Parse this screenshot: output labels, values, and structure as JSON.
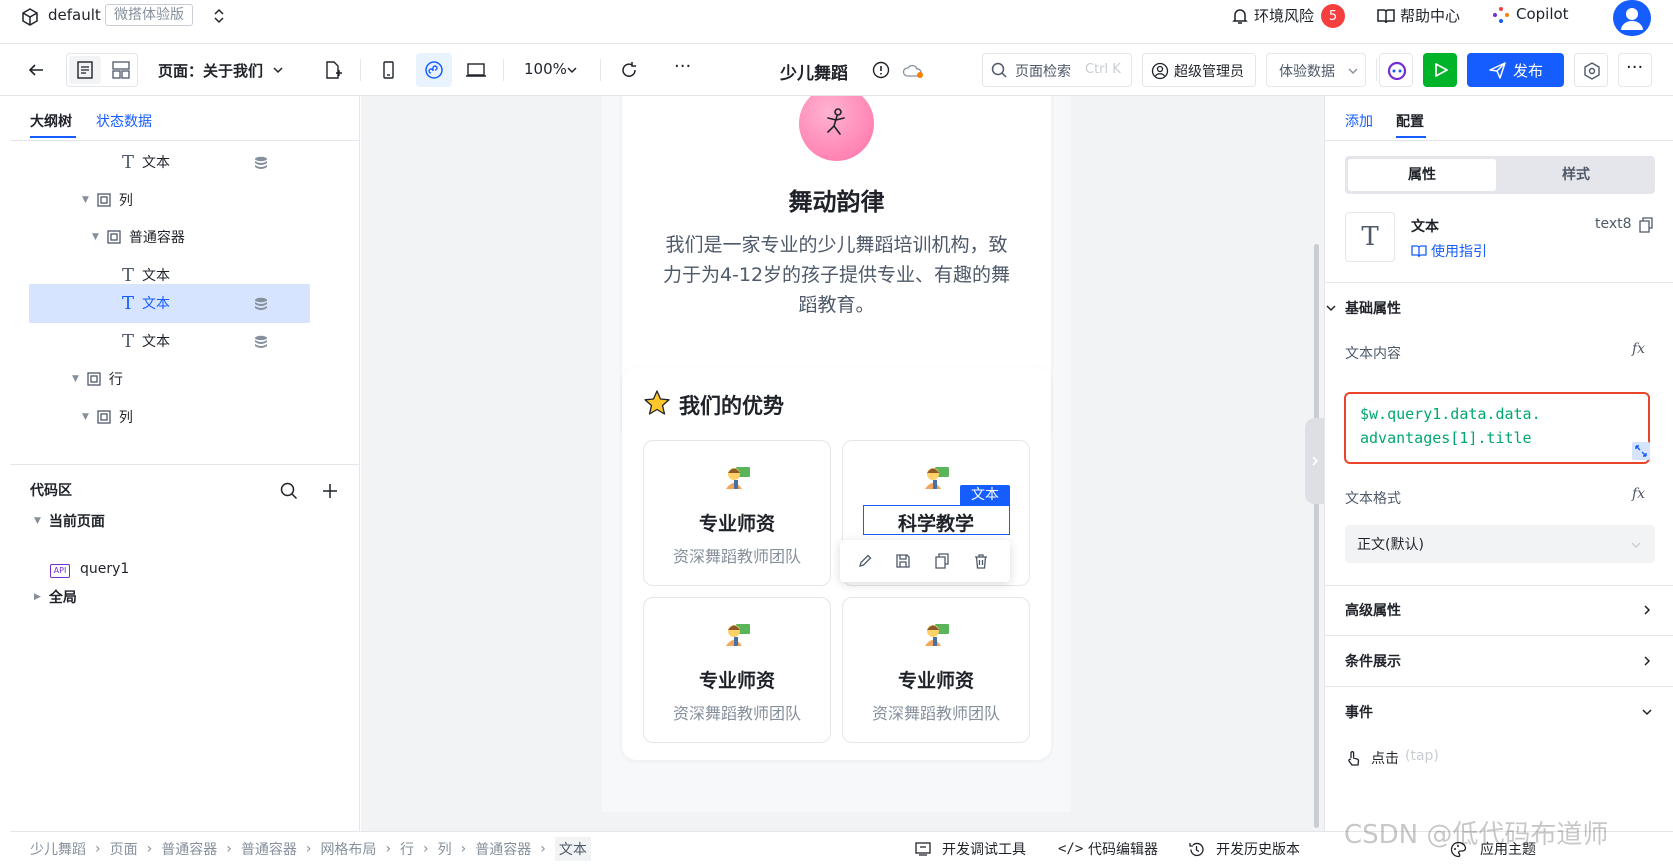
{
  "topbar": {
    "env_name": "default",
    "edition_badge": "微搭体验版",
    "env_risk_label": "环境风险",
    "env_risk_count": "5",
    "help_label": "帮助中心",
    "copilot_label": "Copilot"
  },
  "toolbar": {
    "page_selector": "页面：关于我们",
    "zoom": "100%",
    "app_title": "少儿舞蹈",
    "search_label": "页面检索",
    "search_shortcut": "Ctrl K",
    "admin_label": "超级管理员",
    "data_select": "体验数据",
    "publish_label": "发布",
    "more": "···"
  },
  "left": {
    "tabs": [
      "大纲树",
      "状态数据"
    ],
    "tree": [
      {
        "label": "文本",
        "db": true
      },
      {
        "label": "列",
        "db": false
      },
      {
        "label": "普通容器",
        "db": false
      },
      {
        "label": "文本",
        "db": false
      },
      {
        "label": "文本",
        "db": true
      },
      {
        "label": "文本",
        "db": true
      },
      {
        "label": "行",
        "db": false
      },
      {
        "label": "列",
        "db": false
      }
    ],
    "code_title": "代码区",
    "code_items": [
      "当前页面",
      "query1",
      "全局"
    ],
    "api_tag": "API"
  },
  "canvas": {
    "hero_title": "舞动韵律",
    "hero_desc_1": "我们是一家专业的少儿舞蹈培训机构，致",
    "hero_desc_2": "力于为4-12岁的孩子提供专业、有趣的舞",
    "hero_desc_3": "蹈教育。",
    "adv_title": "我们的优势",
    "features": [
      {
        "title": "专业师资",
        "desc": "资深舞蹈教师团队"
      },
      {
        "title": "科学教学",
        "desc": ""
      },
      {
        "title": "专业师资",
        "desc": "资深舞蹈教师团队"
      },
      {
        "title": "专业师资",
        "desc": "资深舞蹈教师团队"
      }
    ],
    "selection_tag": "文本"
  },
  "right": {
    "tabs": [
      "添加",
      "配置"
    ],
    "seg": [
      "属性",
      "样式"
    ],
    "comp_name": "文本",
    "comp_id": "text8",
    "guide_link": "使用指引",
    "basic_props": "基础属性",
    "text_content_label": "文本内容",
    "code_line_1": "$w.query1.data.data.",
    "code_line_2": "advantages[1].title",
    "text_format_label": "文本格式",
    "text_format_value": "正文(默认)",
    "advanced_props": "高级属性",
    "condition_display": "条件展示",
    "events": "事件",
    "event_click": "点击",
    "event_tap": "(tap)",
    "fx": "fx"
  },
  "bottom": {
    "breadcrumbs": [
      "少儿舞蹈",
      "页面",
      "普通容器",
      "普通容器",
      "网格布局",
      "行",
      "列",
      "普通容器",
      "文本"
    ],
    "devtools": "开发调试工具",
    "code_editor": "代码编辑器",
    "history": "开发历史版本",
    "theme": "应用主题",
    "watermark": "CSDN @低代码布道师"
  }
}
